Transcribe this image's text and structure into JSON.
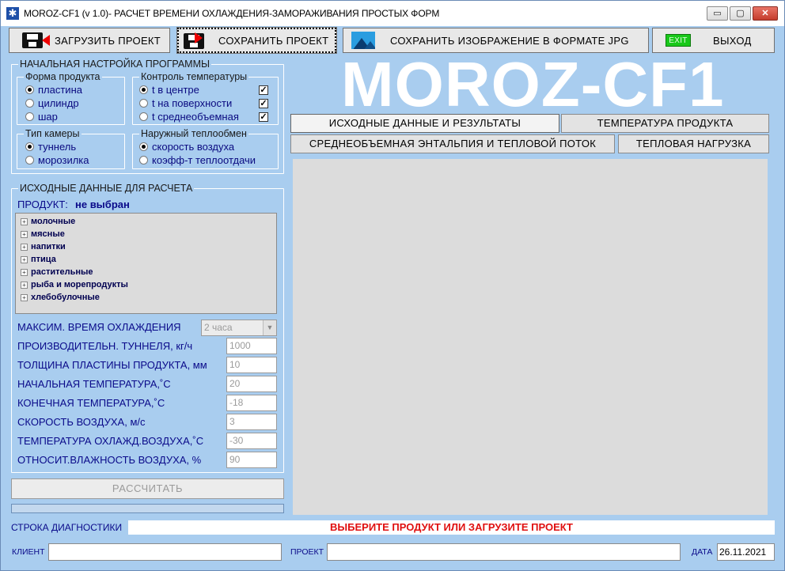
{
  "window": {
    "title": "MOROZ-CF1 (v 1.0)- РАСЧЕТ ВРЕМЕНИ ОХЛАЖДЕНИЯ-ЗАМОРАЖИВАНИЯ ПРОСТЫХ ФОРМ",
    "controls": {
      "minimize": "▭",
      "maximize": "▢",
      "close": "✕"
    }
  },
  "toolbar": {
    "load": "ЗАГРУЗИТЬ  ПРОЕКТ",
    "save": "СОХРАНИТЬ  ПРОЕКТ",
    "save_image": "СОХРАНИТЬ  ИЗОБРАЖЕНИЕ  В  ФОРМАТЕ  JPG",
    "exit_badge": "EXIT",
    "exit": "ВЫХОД"
  },
  "app_title": "MOROZ-CF1",
  "setup": {
    "group_title": "НАЧАЛЬНАЯ НАСТРОЙКА ПРОГРАММЫ",
    "shape": {
      "title": "Форма продукта",
      "options": [
        "пластина",
        "цилиндр",
        "шар"
      ],
      "selected": 0
    },
    "temp_control": {
      "title": "Контроль температуры",
      "options": [
        "t в центре",
        "t на поверхности",
        "t среднеобъемная"
      ],
      "checked": [
        true,
        true,
        true
      ]
    },
    "chamber": {
      "title": "Тип камеры",
      "options": [
        "туннель",
        "морозилка"
      ],
      "selected": 0
    },
    "heat_exchange": {
      "title": "Наружный теплообмен",
      "options": [
        "скорость воздуха",
        "коэфф-т теплоотдачи"
      ],
      "selected": 0
    }
  },
  "input": {
    "group_title": "ИСХОДНЫЕ ДАННЫЕ ДЛЯ РАСЧЕТА",
    "product_label": "ПРОДУКТ:",
    "product_value": "не выбран",
    "tree": [
      "молочные",
      "мясные",
      "напитки",
      "птица",
      "растительные",
      "рыба и морепродукты",
      "хлебобулочные"
    ],
    "max_time_label": "МАКСИМ. ВРЕМЯ ОХЛАЖДЕНИЯ",
    "max_time_value": "2 часа",
    "fields": [
      {
        "label": "ПРОИЗВОДИТЕЛЬН. ТУННЕЛЯ, кг/ч",
        "value": "1000"
      },
      {
        "label": "ТОЛЩИНА ПЛАСТИНЫ ПРОДУКТА, мм",
        "value": "10"
      },
      {
        "label": "НАЧАЛЬНАЯ ТЕМПЕРАТУРА,˚С",
        "value": "20"
      },
      {
        "label": "КОНЕЧНАЯ ТЕМПЕРАТУРА,˚С",
        "value": "-18"
      },
      {
        "label": "СКОРОСТЬ ВОЗДУХА, м/с",
        "value": "3"
      },
      {
        "label": "ТЕМПЕРАТУРА ОХЛАЖД.ВОЗДУХА,˚С",
        "value": "-30"
      },
      {
        "label": "ОТНОСИТ.ВЛАЖНОСТЬ ВОЗДУХА, %",
        "value": "90"
      }
    ],
    "calc_button": "РАССЧИТАТЬ"
  },
  "tabs": [
    "ИСХОДНЫЕ  ДАННЫЕ  И  РЕЗУЛЬТАТЫ",
    "ТЕМПЕРАТУРА  ПРОДУКТА",
    "СРЕДНЕОБЪЕМНАЯ  ЭНТАЛЬПИЯ  И  ТЕПЛОВОЙ  ПОТОК",
    "ТЕПЛОВАЯ   НАГРУЗКА"
  ],
  "diagnostics": {
    "label": "СТРОКА ДИАГНОСТИКИ",
    "message": "ВЫБЕРИТЕ ПРОДУКТ ИЛИ ЗАГРУЗИТЕ ПРОЕКТ"
  },
  "footer": {
    "client_label": "КЛИЕНТ",
    "client_value": "",
    "project_label": "ПРОЕКТ",
    "project_value": "",
    "date_label": "ДАТА",
    "date_value": "26.11.2021"
  },
  "colors": {
    "background": "#a9cdef",
    "title_text": "#ffffff",
    "label_text": "#0a0a8a",
    "diag_text": "#e01010"
  }
}
